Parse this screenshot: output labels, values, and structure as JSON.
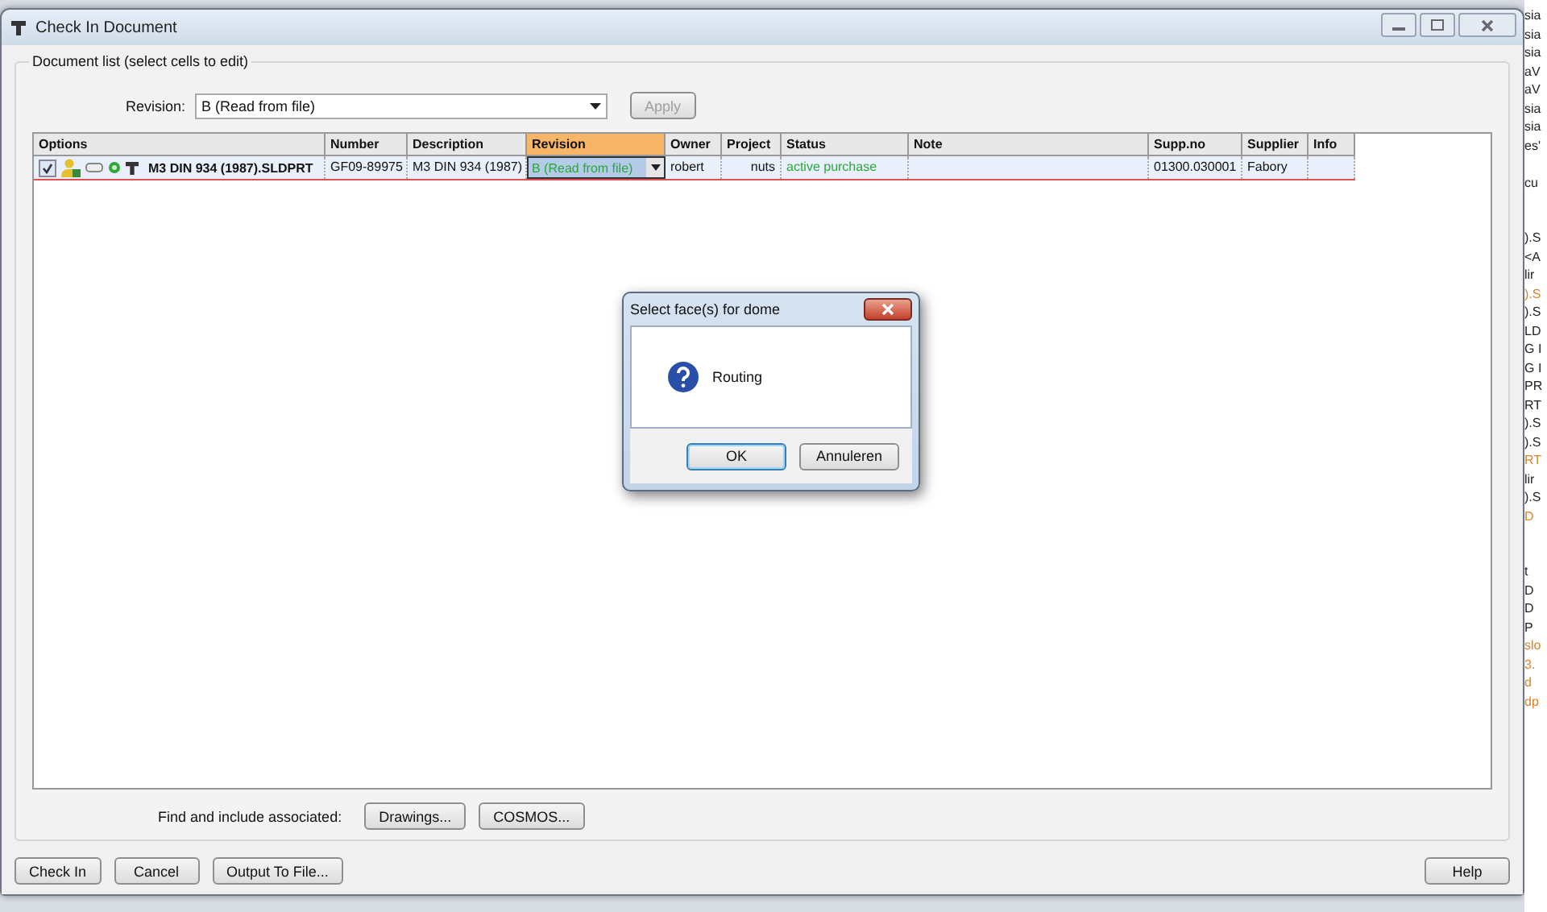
{
  "window": {
    "title": "Check In Document"
  },
  "group": {
    "title": "Document list (select cells to edit)"
  },
  "revision_bar": {
    "label": "Revision:",
    "value": "B  (Read from file)",
    "apply": {
      "label": "Apply",
      "disabled": true
    }
  },
  "table": {
    "columns": [
      {
        "label": "Options",
        "selected": false
      },
      {
        "label": "Number",
        "selected": false
      },
      {
        "label": "Description",
        "selected": false
      },
      {
        "label": "Revision",
        "selected": true
      },
      {
        "label": "Owner",
        "selected": false
      },
      {
        "label": "Project",
        "selected": false
      },
      {
        "label": "Status",
        "selected": false
      },
      {
        "label": "Note",
        "selected": false
      },
      {
        "label": "Supp.no",
        "selected": false
      },
      {
        "label": "Supplier",
        "selected": false
      },
      {
        "label": "Info",
        "selected": false
      }
    ],
    "rows": [
      {
        "checked": true,
        "file": "M3 DIN 934 (1987).SLDPRT",
        "number": "GF09-89975",
        "description": "M3 DIN 934 (1987)",
        "revision": "B  (Read from file)",
        "owner": "robert",
        "project": "nuts",
        "status": "active purchase",
        "note": "",
        "supp_no": "01300.030001",
        "supplier": "Fabory",
        "info": ""
      }
    ]
  },
  "associated": {
    "label": "Find and include associated:",
    "buttons": [
      "Drawings...",
      "COSMOS..."
    ]
  },
  "buttons": [
    "Check In",
    "Cancel",
    "Output To File..."
  ],
  "help": "Help",
  "dialog": {
    "title": "Select face(s) for dome",
    "message": "Routing",
    "buttons": [
      {
        "label": "OK",
        "selected": true
      },
      {
        "label": "Annuleren",
        "selected": false
      }
    ]
  },
  "background_fragments": [
    {
      "text": "sia",
      "kind": "normal"
    },
    {
      "text": "sia",
      "kind": "normal"
    },
    {
      "text": "sia",
      "kind": "normal"
    },
    {
      "text": "aV",
      "kind": "normal"
    },
    {
      "text": "aV",
      "kind": "normal"
    },
    {
      "text": "sia",
      "kind": "normal"
    },
    {
      "text": "sia",
      "kind": "normal"
    },
    {
      "text": "es'",
      "kind": "normal"
    },
    {
      "kind": "gap"
    },
    {
      "text": "cu",
      "kind": "normal"
    },
    {
      "kind": "gap"
    },
    {
      "kind": "gap"
    },
    {
      "text": ").S",
      "kind": "normal"
    },
    {
      "text": "<A",
      "kind": "normal"
    },
    {
      "text": "lir",
      "kind": "normal"
    },
    {
      "text": ").S",
      "kind": "highlight"
    },
    {
      "text": ").S",
      "kind": "normal"
    },
    {
      "text": "LD",
      "kind": "normal"
    },
    {
      "text": "G I",
      "kind": "normal"
    },
    {
      "text": "G I",
      "kind": "normal"
    },
    {
      "text": "PR",
      "kind": "normal"
    },
    {
      "text": "RT",
      "kind": "normal"
    },
    {
      "text": ").S",
      "kind": "normal"
    },
    {
      "text": ").S",
      "kind": "normal"
    },
    {
      "text": "RT",
      "kind": "highlight"
    },
    {
      "text": "lir",
      "kind": "normal"
    },
    {
      "text": ").S",
      "kind": "normal"
    },
    {
      "text": "D",
      "kind": "highlight"
    },
    {
      "kind": "gap"
    },
    {
      "kind": "gap"
    },
    {
      "text": "t",
      "kind": "normal"
    },
    {
      "text": "D",
      "kind": "normal"
    },
    {
      "text": "D",
      "kind": "normal"
    },
    {
      "text": "P",
      "kind": "normal"
    },
    {
      "text": "slo",
      "kind": "highlight"
    },
    {
      "text": "3.",
      "kind": "highlight"
    },
    {
      "text": "d",
      "kind": "highlight"
    },
    {
      "text": "dp",
      "kind": "highlight"
    }
  ]
}
